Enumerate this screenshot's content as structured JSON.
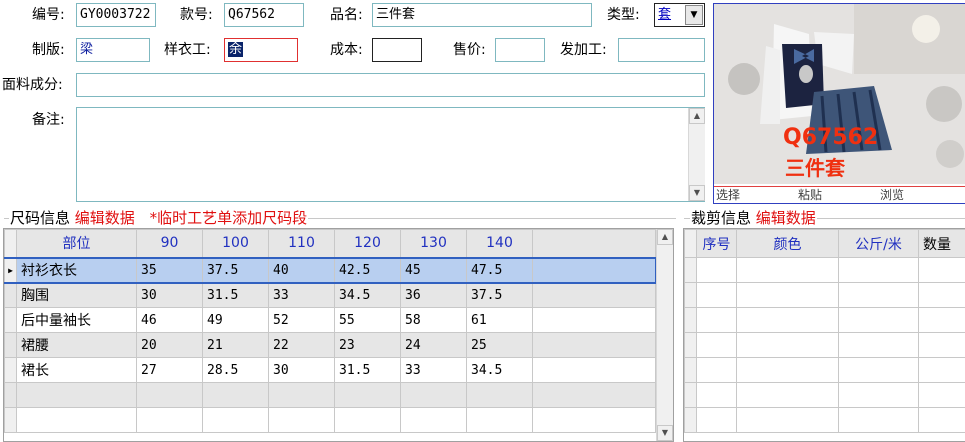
{
  "form": {
    "code_label": "编号:",
    "code_value": "GY0003722",
    "style_label": "款号:",
    "style_value": "Q67562",
    "name_label": "品名:",
    "name_value": "三件套",
    "type_label": "类型:",
    "type_value": "套",
    "maker_label": "制版:",
    "maker_value": "梁",
    "sample_label": "样衣工:",
    "sample_value": "余",
    "cost_label": "成本:",
    "cost_value": "",
    "price_label": "售价:",
    "price_value": "",
    "process_label": "发加工:",
    "process_value": "",
    "fabric_label": "面料成分:",
    "fabric_value": "",
    "remark_label": "备注:",
    "remark_value": ""
  },
  "photo": {
    "overlay_code": "Q67562",
    "overlay_name": "三件套",
    "actions": [
      "选择",
      "粘贴",
      "浏览"
    ]
  },
  "size_panel": {
    "title": "尺码信息",
    "edit_link": "编辑数据",
    "add_link": "*临时工艺单添加尺码段",
    "columns": [
      "部位",
      "90",
      "100",
      "110",
      "120",
      "130",
      "140"
    ],
    "rows": [
      [
        "衬衫衣长",
        "35",
        "37.5",
        "40",
        "42.5",
        "45",
        "47.5"
      ],
      [
        "胸围",
        "30",
        "31.5",
        "33",
        "34.5",
        "36",
        "37.5"
      ],
      [
        "后中量袖长",
        "46",
        "49",
        "52",
        "55",
        "58",
        "61"
      ],
      [
        "裙腰",
        "20",
        "21",
        "22",
        "23",
        "24",
        "25"
      ],
      [
        "裙长",
        "27",
        "28.5",
        "30",
        "31.5",
        "33",
        "34.5"
      ]
    ],
    "selected_row": 0
  },
  "cut_panel": {
    "title": "裁剪信息",
    "edit_link": "编辑数据",
    "columns": [
      "序号",
      "颜色",
      "公斤/米",
      "数量"
    ]
  },
  "colors": {
    "accent_red": "#e01010",
    "header_blue": "#2030c0",
    "selection": "#b8cff0"
  }
}
